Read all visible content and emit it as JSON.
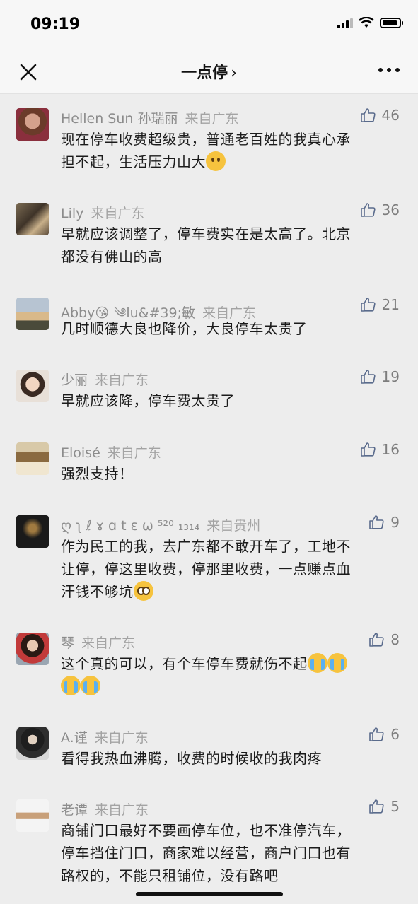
{
  "status": {
    "time": "09:19"
  },
  "nav": {
    "title": "一点停",
    "chevron": "›",
    "close_icon": "close-icon",
    "more_icon": "more-icon"
  },
  "comments": [
    {
      "name": "Hellen Sun 孙瑞丽",
      "from": "来自广东",
      "likes": "46",
      "lines": [
        "现在停车收费超级贵，普通老百姓的我真心承",
        "担不起，生活压力山大"
      ],
      "emoji": [
        "sad"
      ]
    },
    {
      "name": "Lily",
      "from": "来自广东",
      "likes": "36",
      "lines": [
        "早就应该调整了，停车费实在是太高了。北京",
        "都没有佛山的高"
      ],
      "emoji": []
    },
    {
      "name": "Abby😘 ༄lu&#39;敏",
      "from": "来自广东",
      "likes": "21",
      "lines": [
        "几时顺德大良也降价，大良停车太贵了"
      ],
      "emoji": []
    },
    {
      "name": "少丽",
      "from": "来自广东",
      "likes": "19",
      "lines": [
        "早就应该降，停车费太贵了"
      ],
      "emoji": []
    },
    {
      "name": "Eloisé",
      "from": "来自广东",
      "likes": "16",
      "lines": [
        "强烈支持！"
      ],
      "emoji": []
    },
    {
      "name": "ღ ʅ ℓ ɤ ɑ t ɛ ω ⁵²⁰ ₁₃₁₄",
      "from": "来自贵州",
      "likes": "9",
      "lines": [
        "作为民工的我，去广东都不敢开车了，工地不",
        "让停，停这里收费，停那里收费，一点赚点血",
        "汗钱不够坑"
      ],
      "emoji": [
        "plead"
      ]
    },
    {
      "name": "琴",
      "from": "来自广东",
      "likes": "8",
      "lines": [
        "这个真的可以，有个车停车费就伤不起",
        ""
      ],
      "emoji": [
        "cry",
        "cry",
        "cry",
        "cry"
      ]
    },
    {
      "name": "A.谨",
      "from": "来自广东",
      "likes": "6",
      "lines": [
        "看得我热血沸腾，收费的时候收的我肉疼"
      ],
      "emoji": []
    },
    {
      "name": "老谭",
      "from": "来自广东",
      "likes": "5",
      "lines": [
        "商铺门口最好不要画停车位，也不准停汽车，",
        "停车挡住门口，商家难以经营，商户门口也有",
        "路权的，不能只租铺位，没有路吧"
      ],
      "emoji": []
    }
  ],
  "colors": {
    "background": "#ededed",
    "nav_bg": "#f7f7f7",
    "name": "#8c8c8c",
    "text": "#1b1b1b"
  }
}
